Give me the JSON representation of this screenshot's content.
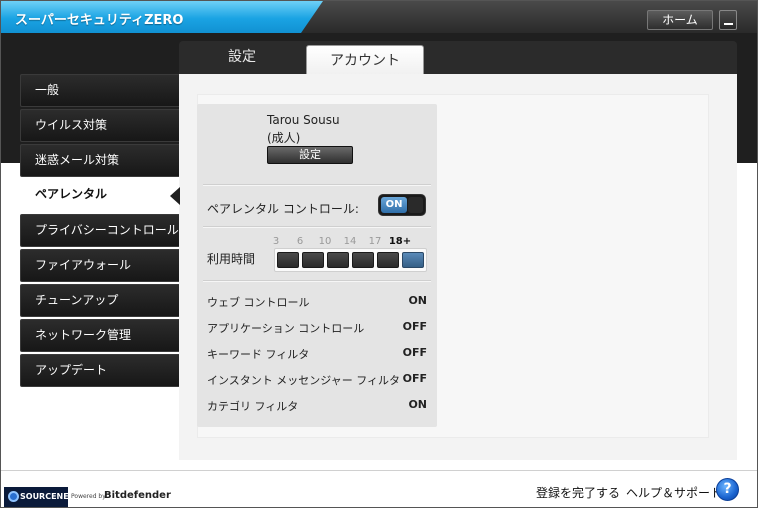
{
  "app": {
    "title": "スーパーセキュリティZERO"
  },
  "titlebar": {
    "home_label": "ホーム"
  },
  "tabs": [
    {
      "label": "設定",
      "selected": false
    },
    {
      "label": "アカウント",
      "selected": true
    }
  ],
  "sidebar": {
    "items": [
      {
        "label": "一般",
        "active": false
      },
      {
        "label": "ウイルス対策",
        "active": false
      },
      {
        "label": "迷惑メール対策",
        "active": false
      },
      {
        "label": "ペアレンタル",
        "active": true
      },
      {
        "label": "プライバシーコントロール",
        "active": false
      },
      {
        "label": "ファイアウォール",
        "active": false
      },
      {
        "label": "チューンアップ",
        "active": false
      },
      {
        "label": "ネットワーク管理",
        "active": false
      },
      {
        "label": "アップデート",
        "active": false
      }
    ]
  },
  "profile": {
    "name": "Tarou Sousu",
    "type": "(成人)",
    "settings_button": "設定"
  },
  "parental_control": {
    "label": "ペアレンタル コントロール:",
    "toggle": "ON"
  },
  "usage_time": {
    "label": "利用時間",
    "ages": [
      "3",
      "6",
      "10",
      "14",
      "17",
      "18+"
    ],
    "selected_index": 5
  },
  "features": [
    {
      "label": "ウェブ コントロール",
      "value": "ON"
    },
    {
      "label": "アプリケーション コントロール",
      "value": "OFF"
    },
    {
      "label": "キーワード フィルタ",
      "value": "OFF"
    },
    {
      "label": "インスタント メッセンジャー フィルタ",
      "value": "OFF"
    },
    {
      "label": "カテゴリ フィルタ",
      "value": "ON"
    }
  ],
  "footer": {
    "logo_text": "SOURCENEXT",
    "powered_by": "Powered by",
    "partner": "Bitdefender",
    "complete_registration": "登録を完了する",
    "help_support": "ヘルプ＆サポート",
    "help_icon_symbol": "?"
  },
  "colors": {
    "title_blue": "#1aa3e3",
    "toggle_on": "#2f6ea8",
    "active_age": "#355f86",
    "help_blue": "#1a64d0"
  }
}
